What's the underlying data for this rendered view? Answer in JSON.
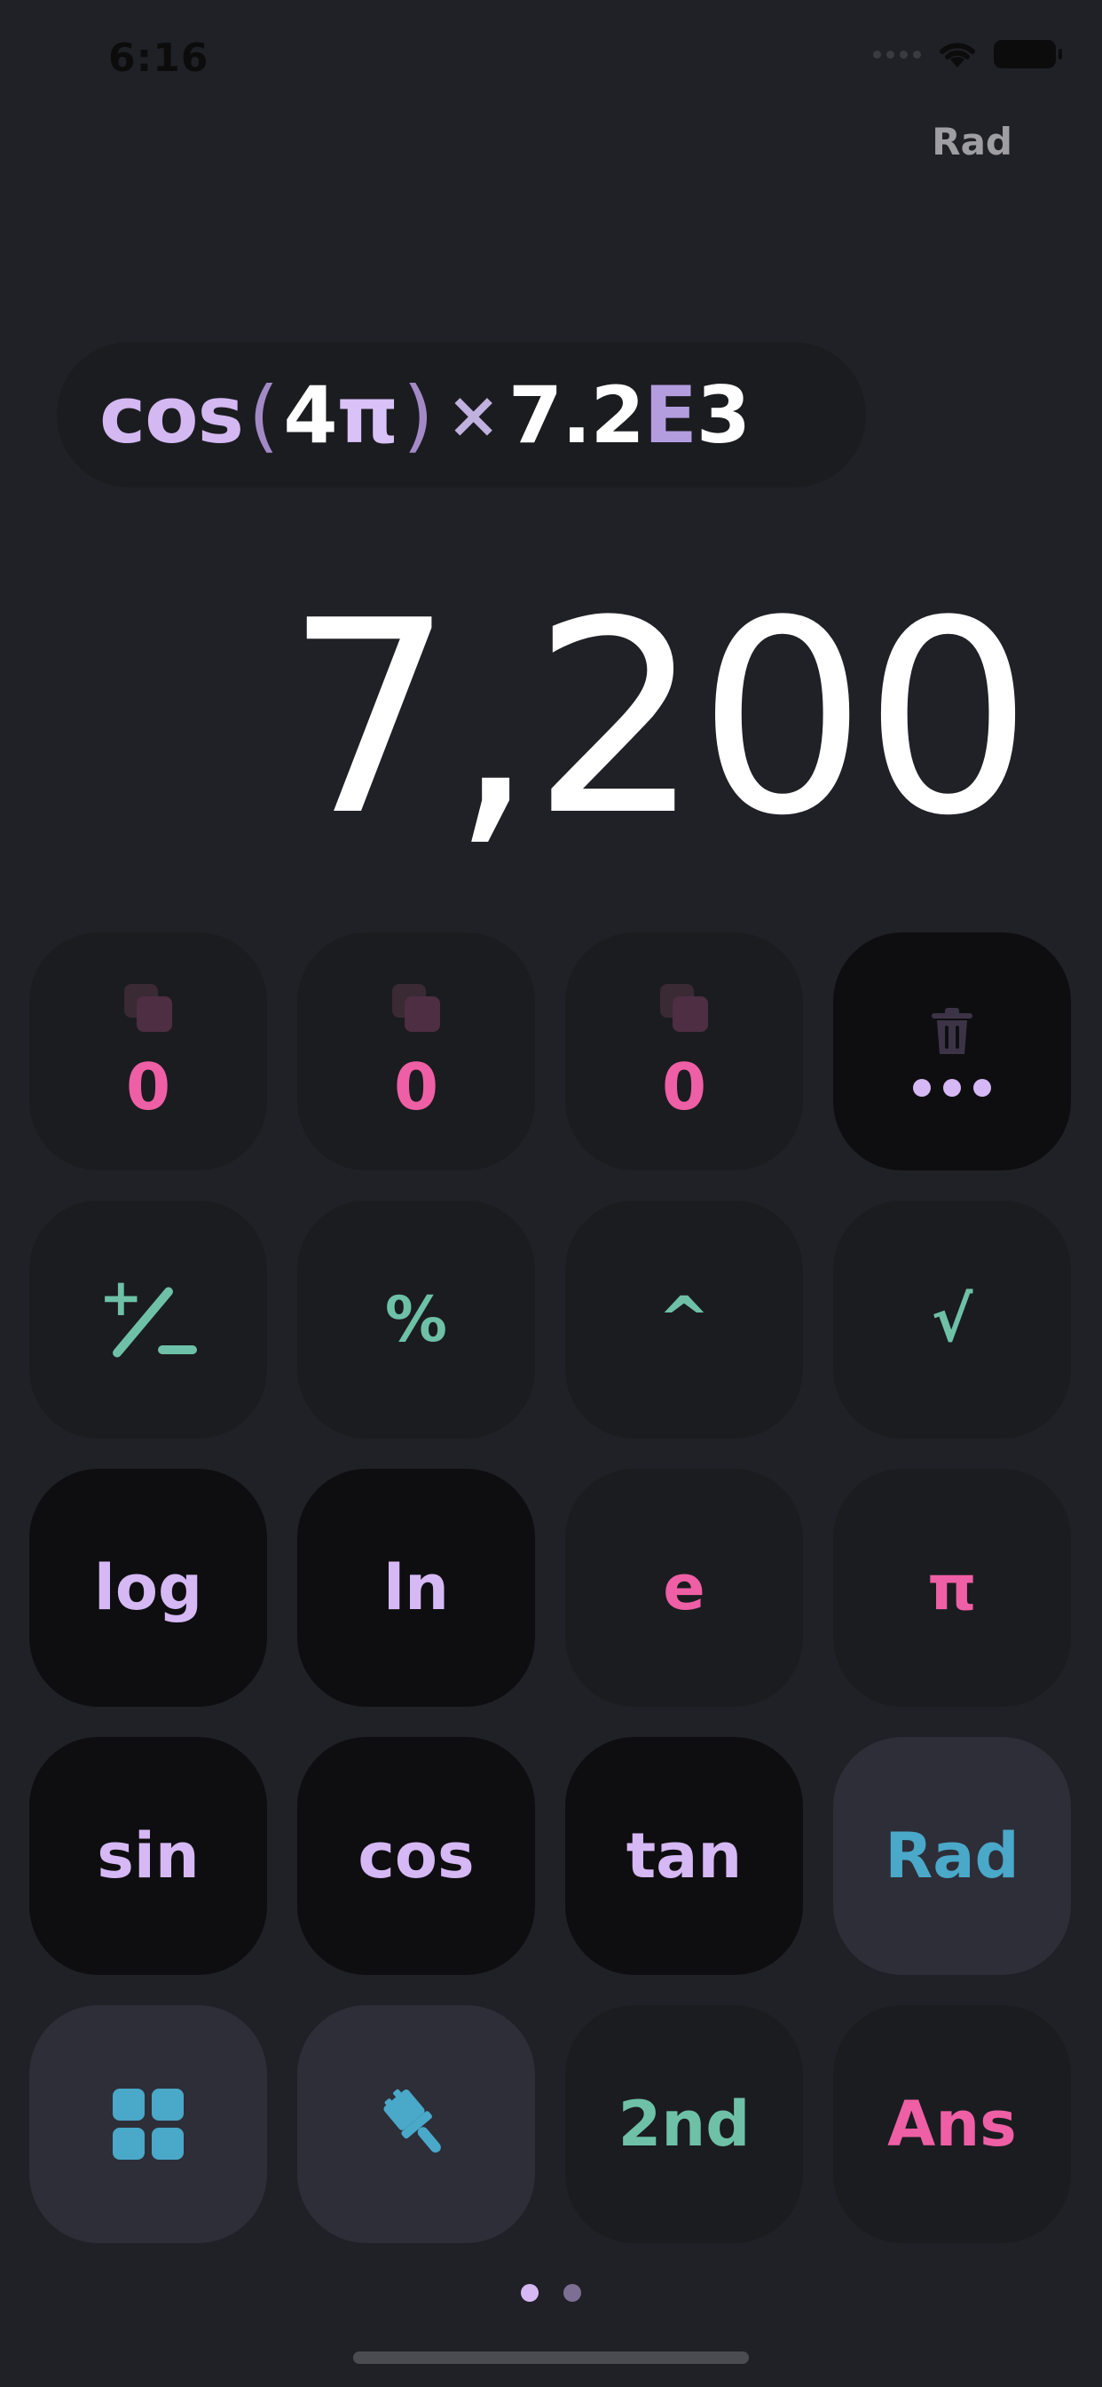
{
  "status_bar": {
    "time": "6:16"
  },
  "mode_toggle": {
    "label": "Rad"
  },
  "expression": {
    "fn": "cos",
    "open_paren": "(",
    "coefficient": "4",
    "pi": "π",
    "close_paren": ")",
    "operator": "×",
    "mantissa": "7.2",
    "exp_marker": "E",
    "exponent": "3"
  },
  "result": {
    "value": "7,200"
  },
  "keypad": {
    "memory_1": "0",
    "memory_2": "0",
    "memory_3": "0",
    "percent": "%",
    "power": "^",
    "sqrt": "√",
    "log": "log",
    "ln": "ln",
    "e": "e",
    "pi": "π",
    "sin": "sin",
    "cos": "cos",
    "tan": "tan",
    "rad": "Rad",
    "second": "2nd",
    "ans": "Ans"
  },
  "icons": {
    "memory": "copy-icon",
    "clear": "trash-icon",
    "more": "more-icon",
    "plus_minus": "plus-minus-icon",
    "layout": "grid-icon",
    "theme": "paintbrush-icon"
  },
  "colors": {
    "background": "#202126",
    "pink": "#ef5fa5",
    "teal": "#6ec1a6",
    "lavender": "#d6b8f5",
    "blue": "#4aa8c9"
  },
  "pager": {
    "pages": 2,
    "current": 1
  }
}
